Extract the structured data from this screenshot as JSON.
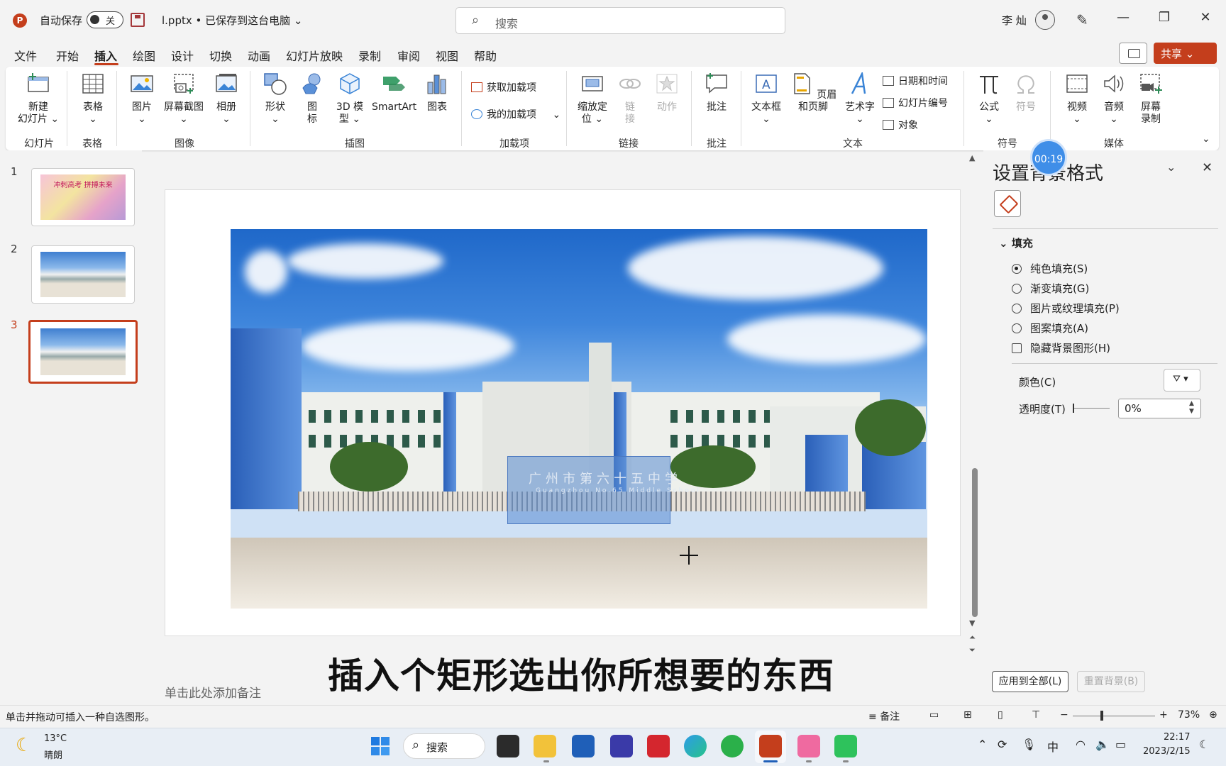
{
  "titlebar": {
    "app_logo": "P",
    "autosave_label": "自动保存",
    "autosave_state": "关",
    "doc_title": "l.pptx • 已保存到这台电脑 ⌄",
    "search_placeholder": "搜索",
    "user_name": "李 灿",
    "minimize": "—",
    "restore": "❐",
    "close": "✕"
  },
  "menu": {
    "items": [
      "文件",
      "开始",
      "插入",
      "绘图",
      "设计",
      "切换",
      "动画",
      "幻灯片放映",
      "录制",
      "审阅",
      "视图",
      "帮助"
    ],
    "active": "插入",
    "share": "共享"
  },
  "ribbon": {
    "new_slide": "新建\n幻灯片 ⌄",
    "table": "表格\n⌄",
    "picture": "图片\n⌄",
    "screenshot": "屏幕截图\n⌄",
    "album": "相册\n⌄",
    "shapes": "形状\n⌄",
    "icons": "图\n标",
    "model3d": "3D 模\n型 ⌄",
    "smartart": "SmartArt",
    "chart": "图表",
    "get_addins": "获取加载项",
    "my_addins": "我的加载项",
    "zoom": "缩放定\n位 ⌄",
    "link": "链\n接",
    "action": "动作",
    "comment": "批注",
    "textbox": "文本框\n⌄",
    "header_footer": "页眉和页脚",
    "wordart": "艺术字\n⌄",
    "datetime": "日期和时间",
    "slide_number": "幻灯片编号",
    "object": "对象",
    "equation": "公式\n⌄",
    "symbol": "符号",
    "video": "视频\n⌄",
    "audio": "音频\n⌄",
    "screen_record": "屏幕\n录制",
    "groups": {
      "slides": "幻灯片",
      "tables": "表格",
      "images": "图像",
      "illustrations": "插图",
      "addins": "加载项",
      "links": "链接",
      "comments": "批注",
      "text": "文本",
      "symbols": "符号",
      "media": "媒体"
    }
  },
  "slides": {
    "numbers": [
      "1",
      "2",
      "3"
    ],
    "active_index": 3,
    "slide1_text": "冲刺高考 拼搏未来"
  },
  "canvas": {
    "sign_text": "广州市第六十五中学",
    "sign_sub": "Guangzhou No.65 Middle School",
    "caption": "插入个矩形选出你所想要的东西",
    "notes_placeholder": "单击此处添加备注"
  },
  "format_pane": {
    "title": "设置背景格式",
    "timer": "00:19",
    "section": "填充",
    "options": [
      "纯色填充(S)",
      "渐变填充(G)",
      "图片或纹理填充(P)",
      "图案填充(A)"
    ],
    "selected_option": "纯色填充(S)",
    "hide_bg": "隐藏背景图形(H)",
    "color_label": "颜色(C)",
    "transparency_label": "透明度(T)",
    "transparency_value": "0%",
    "apply_all": "应用到全部(L)",
    "reset": "重置背景(B)"
  },
  "status": {
    "hint": "单击并拖动可插入一种自选图形。",
    "notes": "备注",
    "zoom": "73%"
  },
  "taskbar": {
    "temp": "13°C",
    "weather": "晴朗",
    "search": "搜索",
    "ime": "中",
    "time": "22:17",
    "date": "2023/2/15"
  }
}
